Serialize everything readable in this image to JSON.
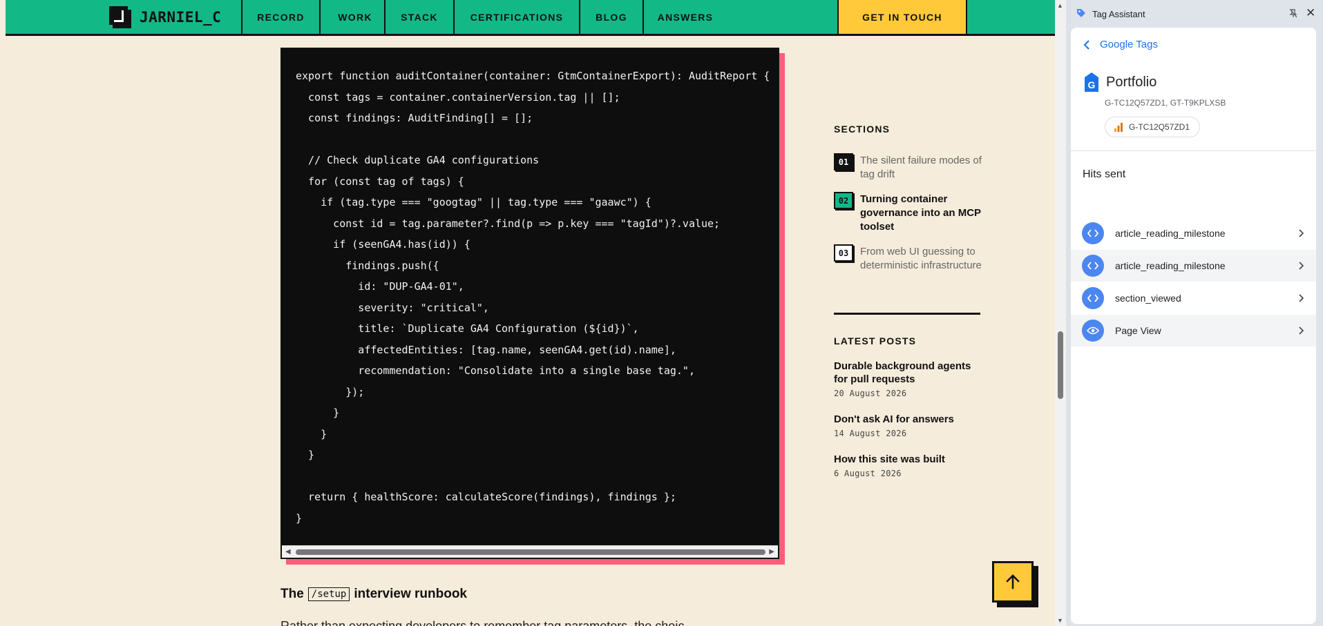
{
  "site": {
    "logo_text": "JARNIEL_C",
    "nav": [
      "RECORD",
      "WORK",
      "STACK",
      "CERTIFICATIONS",
      "BLOG",
      "ANSWERS"
    ],
    "cta": "GET IN TOUCH"
  },
  "code": {
    "lines": [
      "export function auditContainer(container: GtmContainerExport): AuditReport {",
      "  const tags = container.containerVersion.tag || [];",
      "  const findings: AuditFinding[] = [];",
      "",
      "  // Check duplicate GA4 configurations",
      "  for (const tag of tags) {",
      "    if (tag.type === \"googtag\" || tag.type === \"gaawc\") {",
      "      const id = tag.parameter?.find(p => p.key === \"tagId\")?.value;",
      "      if (seenGA4.has(id)) {",
      "        findings.push({",
      "          id: \"DUP-GA4-01\",",
      "          severity: \"critical\",",
      "          title: `Duplicate GA4 Configuration (${id})`,",
      "          affectedEntities: [tag.name, seenGA4.get(id).name],",
      "          recommendation: \"Consolidate into a single base tag.\",",
      "        });",
      "      }",
      "    }",
      "  }",
      "",
      "  return { healthScore: calculateScore(findings), findings };",
      "}"
    ]
  },
  "article": {
    "heading_prefix": "The",
    "heading_code": "/setup",
    "heading_suffix": "interview runbook",
    "cut_text": "Rather than expecting developers to remember tag parameters, the choic"
  },
  "sidebar": {
    "sections_title": "SECTIONS",
    "sections": [
      {
        "num": "01",
        "text": "The silent failure modes of tag drift",
        "state": "dark"
      },
      {
        "num": "02",
        "text": "Turning container governance into an MCP toolset",
        "state": "active"
      },
      {
        "num": "03",
        "text": "From web UI guessing to deterministic infrastructure",
        "state": "light"
      }
    ],
    "latest_title": "LATEST POSTS",
    "posts": [
      {
        "title": "Durable background agents for pull requests",
        "date": "20 August 2026"
      },
      {
        "title": "Don't ask AI for answers",
        "date": "14 August 2026"
      },
      {
        "title": "How this site was built",
        "date": "6 August 2026"
      }
    ]
  },
  "panel": {
    "title": "Tag Assistant",
    "back_label": "Google Tags",
    "container_name": "Portfolio",
    "container_ids": "G-TC12Q57ZD1, GT-T9KPLXSB",
    "chip_label": "G-TC12Q57ZD1",
    "hits_title": "Hits sent",
    "hits": [
      {
        "label": "article_reading_milestone",
        "icon": "code-icon"
      },
      {
        "label": "article_reading_milestone",
        "icon": "code-icon"
      },
      {
        "label": "section_viewed",
        "icon": "code-icon"
      },
      {
        "label": "Page View",
        "icon": "eye-icon"
      }
    ]
  },
  "colors": {
    "nav_green": "#13b887",
    "cta_yellow": "#ffc93a",
    "page_bg": "#f5ecdb",
    "code_shadow": "#ff5c7c",
    "hit_blue": "#4c86f0",
    "link_blue": "#1a73e8"
  }
}
